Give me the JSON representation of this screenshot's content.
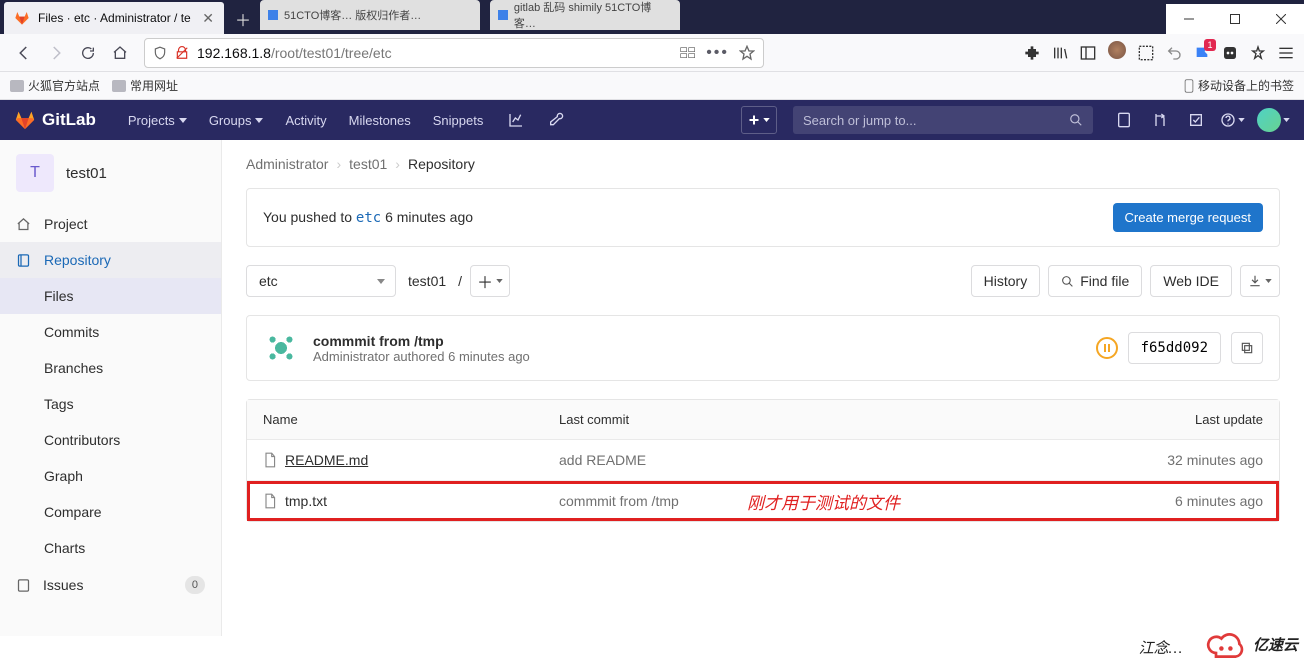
{
  "browser": {
    "tab_title": "Files · etc · Administrator / te",
    "partial_tab1": "51CTO博客… 版权归作者…",
    "partial_tab2": "gitlab 乱码 shimily 51CTO博客…",
    "url_host": "192.168.1.8",
    "url_path": "/root/test01/tree/etc",
    "bookmarks": {
      "b1": "火狐官方站点",
      "b2": "常用网址",
      "mobile": "移动设备上的书签"
    }
  },
  "gitlab": {
    "brand": "GitLab",
    "nav": {
      "projects": "Projects",
      "groups": "Groups",
      "activity": "Activity",
      "milestones": "Milestones",
      "snippets": "Snippets"
    },
    "search_placeholder": "Search or jump to..."
  },
  "sidebar": {
    "project_initial": "T",
    "project_name": "test01",
    "items": {
      "project": "Project",
      "repository": "Repository",
      "files": "Files",
      "commits": "Commits",
      "branches": "Branches",
      "tags": "Tags",
      "contributors": "Contributors",
      "graph": "Graph",
      "compare": "Compare",
      "charts": "Charts",
      "issues": "Issues",
      "issues_count": "0"
    }
  },
  "breadcrumbs": {
    "owner": "Administrator",
    "project": "test01",
    "page": "Repository"
  },
  "push_banner": {
    "prefix": "You pushed to ",
    "branch": "etc",
    "time": " 6 minutes ago",
    "button": "Create merge request"
  },
  "toolbar": {
    "branch": "etc",
    "project_path": "test01",
    "slash": "/",
    "history": "History",
    "find_file": "Find file",
    "web_ide": "Web IDE"
  },
  "last_commit": {
    "title": "commmit from /tmp",
    "author": "Administrator",
    "authored": " authored 6 minutes ago",
    "sha": "f65dd092"
  },
  "table": {
    "head": {
      "name": "Name",
      "commit": "Last commit",
      "update": "Last update"
    },
    "rows": [
      {
        "name": "README.md",
        "commit": "add README",
        "update": "32 minutes ago"
      },
      {
        "name": "tmp.txt",
        "commit": "commmit from /tmp",
        "update": "6 minutes ago"
      }
    ]
  },
  "annotation": "刚才用于测试的文件",
  "watermark": {
    "name": "江念…",
    "brand": "亿速云"
  }
}
